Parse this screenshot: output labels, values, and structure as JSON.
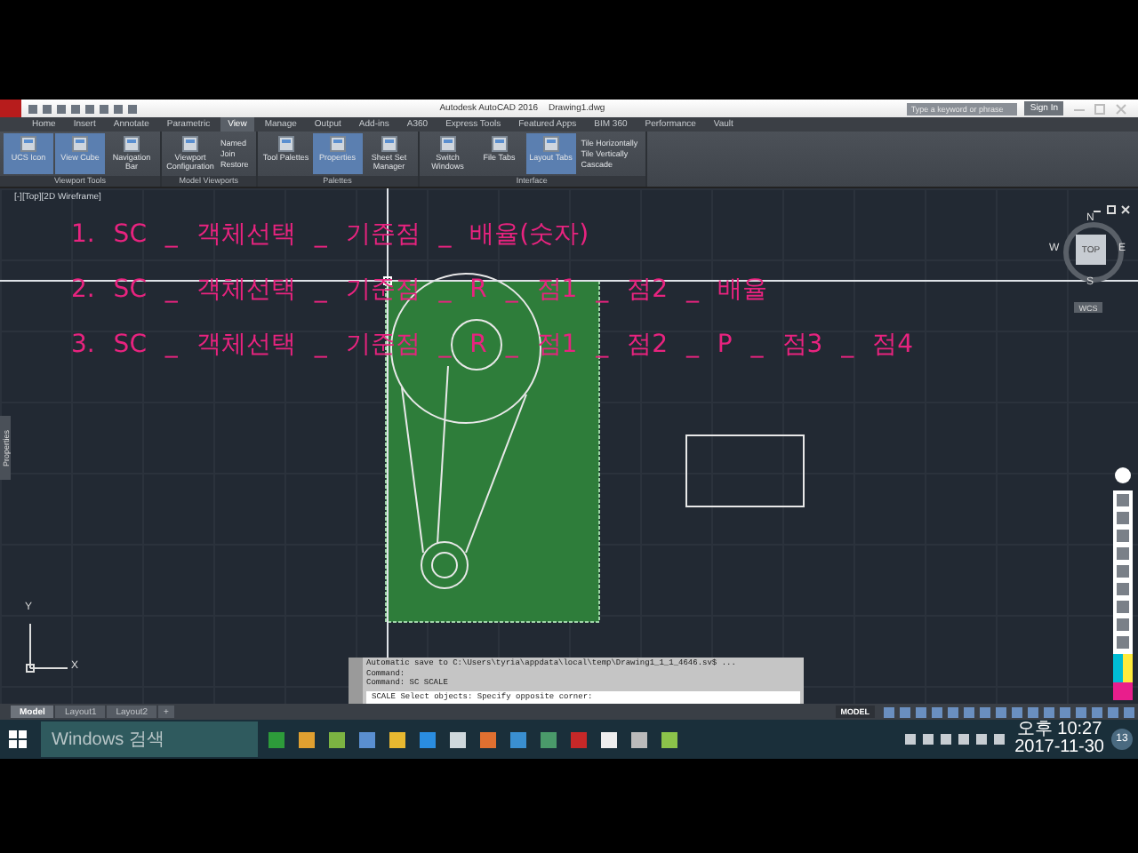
{
  "title_bar": {
    "title": "Autodesk AutoCAD 2016",
    "filename": "Drawing1.dwg",
    "search": {
      "placeholder": "Type a keyword or phrase"
    },
    "sign_in": "Sign In"
  },
  "ribbon_tabs": [
    {
      "label": "Home",
      "selected": false
    },
    {
      "label": "Insert",
      "selected": false
    },
    {
      "label": "Annotate",
      "selected": false
    },
    {
      "label": "Parametric",
      "selected": false
    },
    {
      "label": "View",
      "selected": true
    },
    {
      "label": "Manage",
      "selected": false
    },
    {
      "label": "Output",
      "selected": false
    },
    {
      "label": "Add-ins",
      "selected": false
    },
    {
      "label": "A360",
      "selected": false
    },
    {
      "label": "Express Tools",
      "selected": false
    },
    {
      "label": "Featured Apps",
      "selected": false
    },
    {
      "label": "BIM 360",
      "selected": false
    },
    {
      "label": "Performance",
      "selected": false
    },
    {
      "label": "Vault",
      "selected": false
    }
  ],
  "ribbon_panels": [
    {
      "title": "Viewport Tools",
      "buttons": [
        {
          "label": "UCS Icon",
          "selected": true
        },
        {
          "label": "View Cube",
          "selected": true
        },
        {
          "label": "Navigation Bar",
          "selected": false
        }
      ]
    },
    {
      "title": "Model Viewports",
      "buttons": [
        {
          "label": "Viewport Configuration",
          "selected": false
        }
      ],
      "small_buttons": [
        "Named",
        "Join",
        "Restore"
      ]
    },
    {
      "title": "Palettes",
      "buttons": [
        {
          "label": "Tool Palettes",
          "selected": false
        },
        {
          "label": "Properties",
          "selected": true
        },
        {
          "label": "Sheet Set Manager",
          "selected": false
        }
      ]
    },
    {
      "title": "Interface",
      "buttons": [
        {
          "label": "Switch Windows",
          "selected": false
        },
        {
          "label": "File Tabs",
          "selected": false
        },
        {
          "label": "Layout Tabs",
          "selected": true
        }
      ],
      "small_buttons": [
        "Tile Horizontally",
        "Tile Vertically",
        "Cascade"
      ]
    }
  ],
  "viewport": {
    "label": "[-][Top][2D Wireframe]",
    "side_palette": "Properties",
    "notes": [
      "1. SC _ 객체선택 _ 기준점 _ 배율(숫자)",
      "2. SC _ 객체선택 _ 기준점 _ R _ 점1 _ 점2 _ 배율",
      "3. SC _ 객체선택 _ 기준점 _ R _ 점1 _ 점2 _ P _ 점3 _ 점4"
    ],
    "viewcube": {
      "top": "TOP",
      "north": "N",
      "south": "S",
      "east": "E",
      "west": "W",
      "wcs": "WCS"
    },
    "ucs": {
      "x": "X",
      "y": "Y"
    }
  },
  "command_window": {
    "history": [
      "Automatic save to C:\\Users\\tyria\\appdata\\local\\temp\\Drawing1_1_1_4646.sv$ ...",
      "Command:",
      "Command: SC SCALE"
    ],
    "prompt": "SCALE Select objects: Specify opposite corner:"
  },
  "layout_tabs": [
    {
      "label": "Model",
      "selected": true
    },
    {
      "label": "Layout1",
      "selected": false
    },
    {
      "label": "Layout2",
      "selected": false
    }
  ],
  "add_tab": "+",
  "status_bar": {
    "mode": "MODEL"
  },
  "taskbar": {
    "search": {
      "placeholder": "Windows 검색"
    },
    "time": "오후 10:27",
    "date": "2017-11-30",
    "notifications": "13"
  }
}
